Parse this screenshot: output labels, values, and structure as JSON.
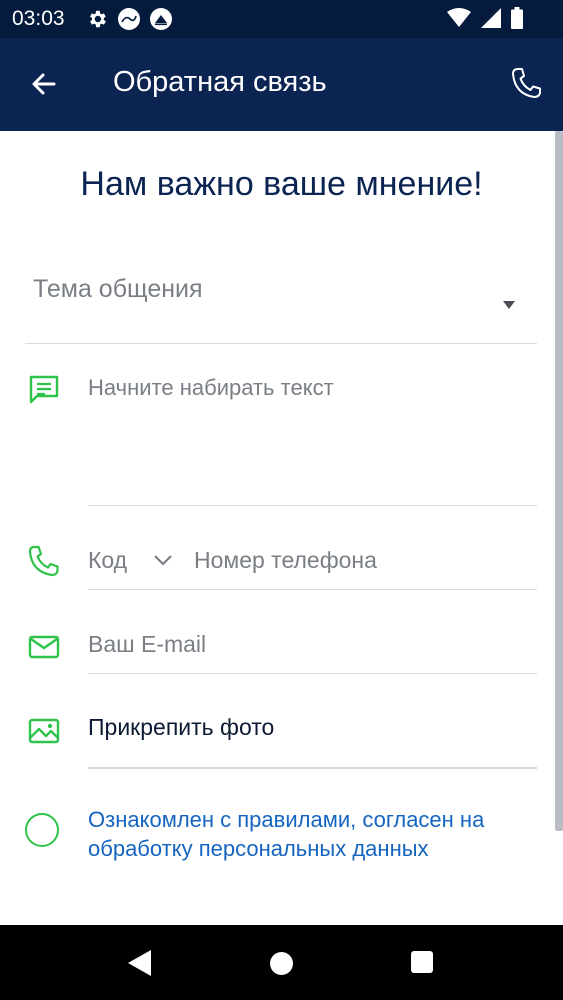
{
  "status_bar": {
    "time": "03:03",
    "icons": [
      "gear-icon",
      "app-logo-icon",
      "app-badge-icon",
      "wifi-icon",
      "signal-icon",
      "battery-icon"
    ]
  },
  "app_bar": {
    "title": "Обратная связь",
    "icons": [
      "back-arrow-icon",
      "phone-icon"
    ]
  },
  "form": {
    "headline": "Нам важно ваше мнение!",
    "topic_label": "Тема общения",
    "message_placeholder": "Начните набирать текст",
    "phone_code_label": "Код",
    "phone_placeholder": "Номер телефона",
    "email_placeholder": "Ваш E-mail",
    "attach_photo_label": "Прикрепить фото",
    "consent_text": "Ознакомлен с правилами, согласен на обработку персональных данных",
    "consent_checked": false
  },
  "colors": {
    "app_bar": "#0b2452",
    "status_bar": "#051b3e",
    "accent_green": "#2fc34a",
    "link_blue": "#1565c0",
    "headline_navy": "#0b2452"
  }
}
